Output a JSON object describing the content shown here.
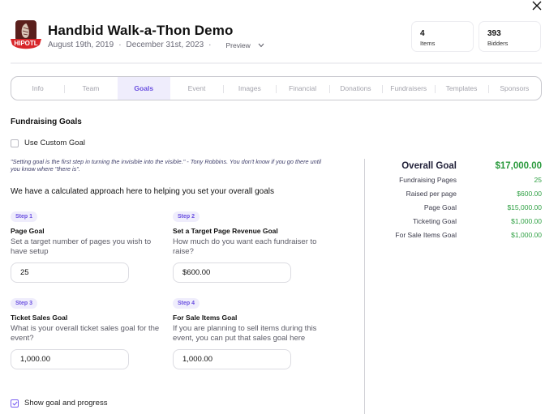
{
  "header": {
    "title": "Handbid Walk-a-Thon Demo",
    "start_date": "August 19th, 2019",
    "end_date": "December 31st, 2023",
    "separator": "·",
    "preview_label": "Preview",
    "logo_text": "HIPOTL"
  },
  "stats": [
    {
      "value": "4",
      "label": "Items"
    },
    {
      "value": "393",
      "label": "Bidders"
    }
  ],
  "tabs": [
    {
      "label": "Info",
      "active": false
    },
    {
      "label": "Team",
      "active": false
    },
    {
      "label": "Goals",
      "active": true
    },
    {
      "label": "Event",
      "active": false
    },
    {
      "label": "Images",
      "active": false
    },
    {
      "label": "Financial",
      "active": false
    },
    {
      "label": "Donations",
      "active": false
    },
    {
      "label": "Fundraisers",
      "active": false
    },
    {
      "label": "Templates",
      "active": false
    },
    {
      "label": "Sponsors",
      "active": false
    }
  ],
  "goals": {
    "section_title": "Fundraising Goals",
    "custom_goal_label": "Use Custom Goal",
    "custom_goal_checked": false,
    "quote": "\"Setting goal is the first step in turning the invisible into the visible.\" - Tony Robbins. You don't know if you go there until you know where \"there is\".",
    "intro": "We have a calculated approach here to helping you set your overall goals",
    "steps": [
      {
        "badge": "Step 1",
        "title": "Page Goal",
        "description": "Set a target number of pages you wish to have setup",
        "value": "25"
      },
      {
        "badge": "Step 2",
        "title": "Set a Target Page Revenue Goal",
        "description": "How much do you want each fundraiser to raise?",
        "value": "$600.00"
      },
      {
        "badge": "Step 3",
        "title": "Ticket Sales Goal",
        "description": "What is your overall ticket sales goal for the event?",
        "value": "1,000.00"
      },
      {
        "badge": "Step 4",
        "title": "For Sale Items Goal",
        "description": "If you are planning to sell items during this event, you can put that sales goal here",
        "value": "1,000.00"
      }
    ],
    "show_progress_label": "Show goal and progress",
    "show_progress_checked": true
  },
  "summary": {
    "overall_label": "Overall Goal",
    "overall_value": "$17,000.00",
    "rows": [
      {
        "label": "Fundraising Pages",
        "value": "25"
      },
      {
        "label": "Raised per page",
        "value": "$600.00"
      },
      {
        "label": "Page Goal",
        "value": "$15,000.00"
      },
      {
        "label": "Ticketing Goal",
        "value": "$1,000.00"
      },
      {
        "label": "For Sale Items Goal",
        "value": "$1,000.00"
      }
    ]
  },
  "colors": {
    "accent": "#6a4fe0",
    "accent_bg": "#efedfc",
    "success": "#2ea043"
  }
}
